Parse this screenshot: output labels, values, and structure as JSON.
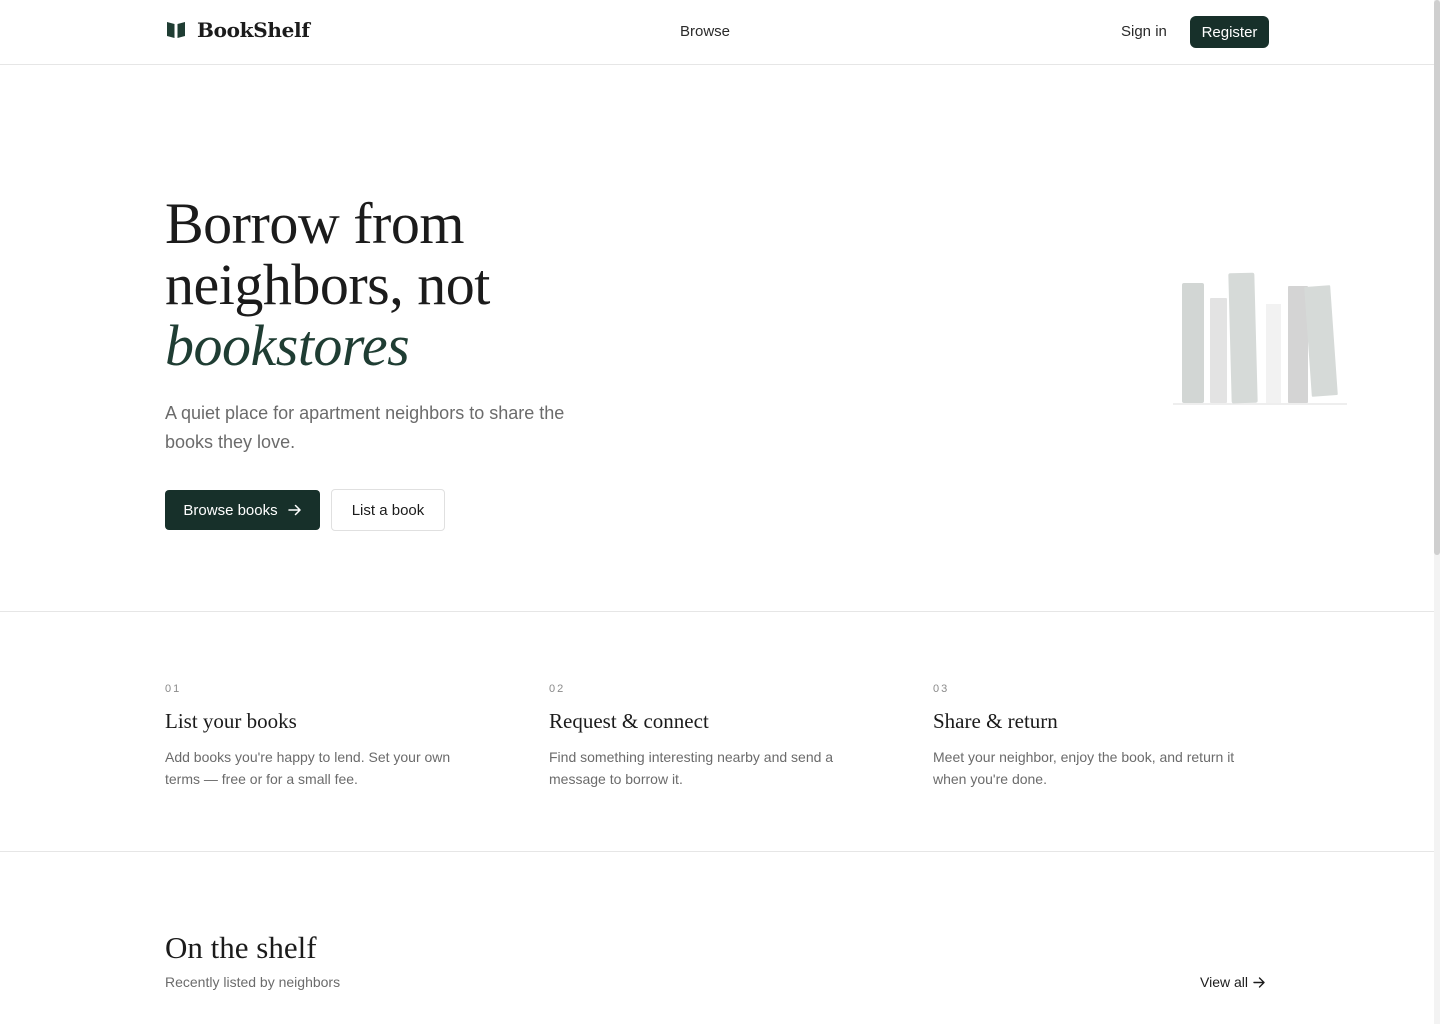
{
  "header": {
    "brand": "BookShelf",
    "brand_icon": "book-open-icon",
    "nav_browse": "Browse",
    "sign_in": "Sign in",
    "register": "Register"
  },
  "hero": {
    "title_line1": "Borrow from",
    "title_line2": "neighbors, not",
    "title_accent": "bookstores",
    "subtitle": "A quiet place for apartment neighbors to share the books they love.",
    "primary_button": "Browse books",
    "secondary_button": "List a book",
    "arrow_icon": "arrow-right-icon"
  },
  "steps": [
    {
      "num": "01",
      "title": "List your books",
      "desc": "Add books you're happy to lend. Set your own terms — free or for a small fee."
    },
    {
      "num": "02",
      "title": "Request & connect",
      "desc": "Find something interesting nearby and send a message to borrow it."
    },
    {
      "num": "03",
      "title": "Share & return",
      "desc": "Meet your neighbor, enjoy the book, and return it when you're done."
    }
  ],
  "shelf": {
    "title": "On the shelf",
    "subtitle": "Recently listed by neighbors",
    "view_all": "View all"
  },
  "colors": {
    "brand_dark": "#17302a",
    "accent_green": "#1f3d33",
    "muted_text": "#6b6b6b",
    "border": "#e6e6e6"
  }
}
